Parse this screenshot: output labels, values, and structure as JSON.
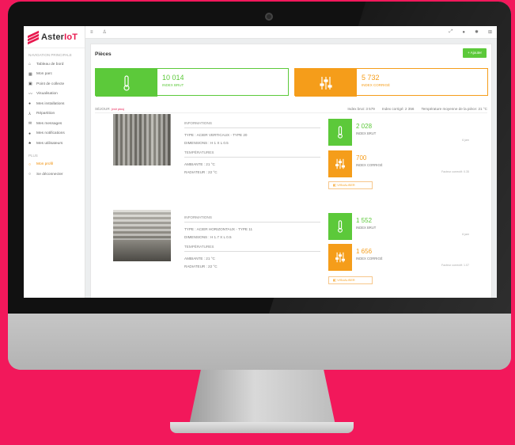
{
  "brand": {
    "name": "Aster",
    "suffix": "IoT"
  },
  "colors": {
    "accent": "#e8194f",
    "green": "#5cc93a",
    "orange": "#f59d1a",
    "background": "#f2185b"
  },
  "sidebar": {
    "heading": "NAVIGATION PRINCIPALE",
    "items": [
      {
        "label": "Tableau de bord",
        "icon": "home-icon"
      },
      {
        "label": "Mon parc",
        "icon": "grid-icon"
      },
      {
        "label": "Point de collecte",
        "icon": "collect-point-icon"
      },
      {
        "label": "Visualisation",
        "icon": "chart-line-icon"
      },
      {
        "label": "Mes installations",
        "icon": "installations-icon"
      },
      {
        "label": "Répartition",
        "icon": "sitemap-icon"
      },
      {
        "label": "Mes messages",
        "icon": "envelope-icon"
      },
      {
        "label": "Mes notifications",
        "icon": "bell-icon"
      },
      {
        "label": "Mes utilisateurs",
        "icon": "users-icon"
      }
    ],
    "heading2": "PLUS",
    "items2": [
      {
        "label": "Mon profil",
        "icon": "user-circle-icon"
      },
      {
        "label": "Se déconnecter",
        "icon": "power-icon"
      }
    ]
  },
  "topbar": {
    "icons": [
      "menu-icon",
      "user-icon",
      "expand-icon",
      "bell-icon",
      "gear-icon",
      "grid-icon"
    ]
  },
  "page": {
    "title": "Pièces",
    "add_label": "+ Ajouter"
  },
  "summary": {
    "brut": {
      "value": "10 014",
      "label": "INDEX BRUT"
    },
    "corrige": {
      "value": "5 732",
      "label": "INDEX CORRIGÉ"
    }
  },
  "room": {
    "name": "SÉJOUR",
    "see_label": "(voir plus)",
    "stats": [
      {
        "label": "Index brut: 3 579"
      },
      {
        "label": "Index corrigé: 2 356"
      },
      {
        "label": "Température moyenne de la pièce: 21 °C"
      }
    ]
  },
  "radiators": [
    {
      "info_heading": "INFORMATIONS",
      "type": "TYPE : ACIER VERTICAUX - TYPE 20",
      "dims": "DIMENSIONS : H 1 X L 0.5",
      "temp_heading": "TEMPÉRATURES",
      "ambient": "AMBIANTE : 21 °C",
      "radiator": "RADIATEUR : 22 °C",
      "brut": {
        "value": "2 028",
        "label": "INDEX BRUT",
        "sub": "6 jam"
      },
      "corrige": {
        "value": "700",
        "label": "INDEX CORRIGÉ",
        "sub": "Facteur correctif: 0.35"
      },
      "button": "VISUALISER"
    },
    {
      "info_heading": "INFORMATIONS",
      "type": "TYPE : ACIER HORIZONTAUX - TYPE 11",
      "dims": "DIMENSIONS : H 1.7 X L 0.5",
      "temp_heading": "TEMPÉRATURES",
      "ambient": "AMBIANTE : 21 °C",
      "radiator": "RADIATEUR : 22 °C",
      "brut": {
        "value": "1 552",
        "label": "INDEX BRUT",
        "sub": "6 jam"
      },
      "corrige": {
        "value": "1 656",
        "label": "INDEX CORRIGÉ",
        "sub": "Facteur correctif: 1.07"
      },
      "button": "VISUALISER"
    }
  ]
}
